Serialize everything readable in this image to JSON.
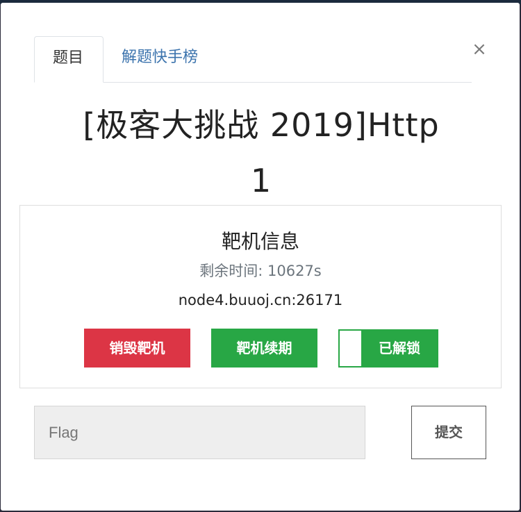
{
  "modal": {
    "tabs": [
      {
        "label": "题目"
      },
      {
        "label": "解题快手榜"
      }
    ],
    "close_icon": "×",
    "title_line1": "[极客大挑战 2019]Http",
    "title_line2": "1"
  },
  "machine": {
    "heading": "靶机信息",
    "remaining": "剩余时间: 10627s",
    "address": "node4.buuoj.cn:26171",
    "destroy_label": "销毁靶机",
    "renew_label": "靶机续期",
    "unlocked_label": "已解锁",
    "unlocked": true
  },
  "flag": {
    "placeholder": "Flag",
    "value": "",
    "submit_label": "提交"
  },
  "colors": {
    "danger": "#dc3545",
    "success": "#28a745",
    "link": "#3b73ad"
  }
}
